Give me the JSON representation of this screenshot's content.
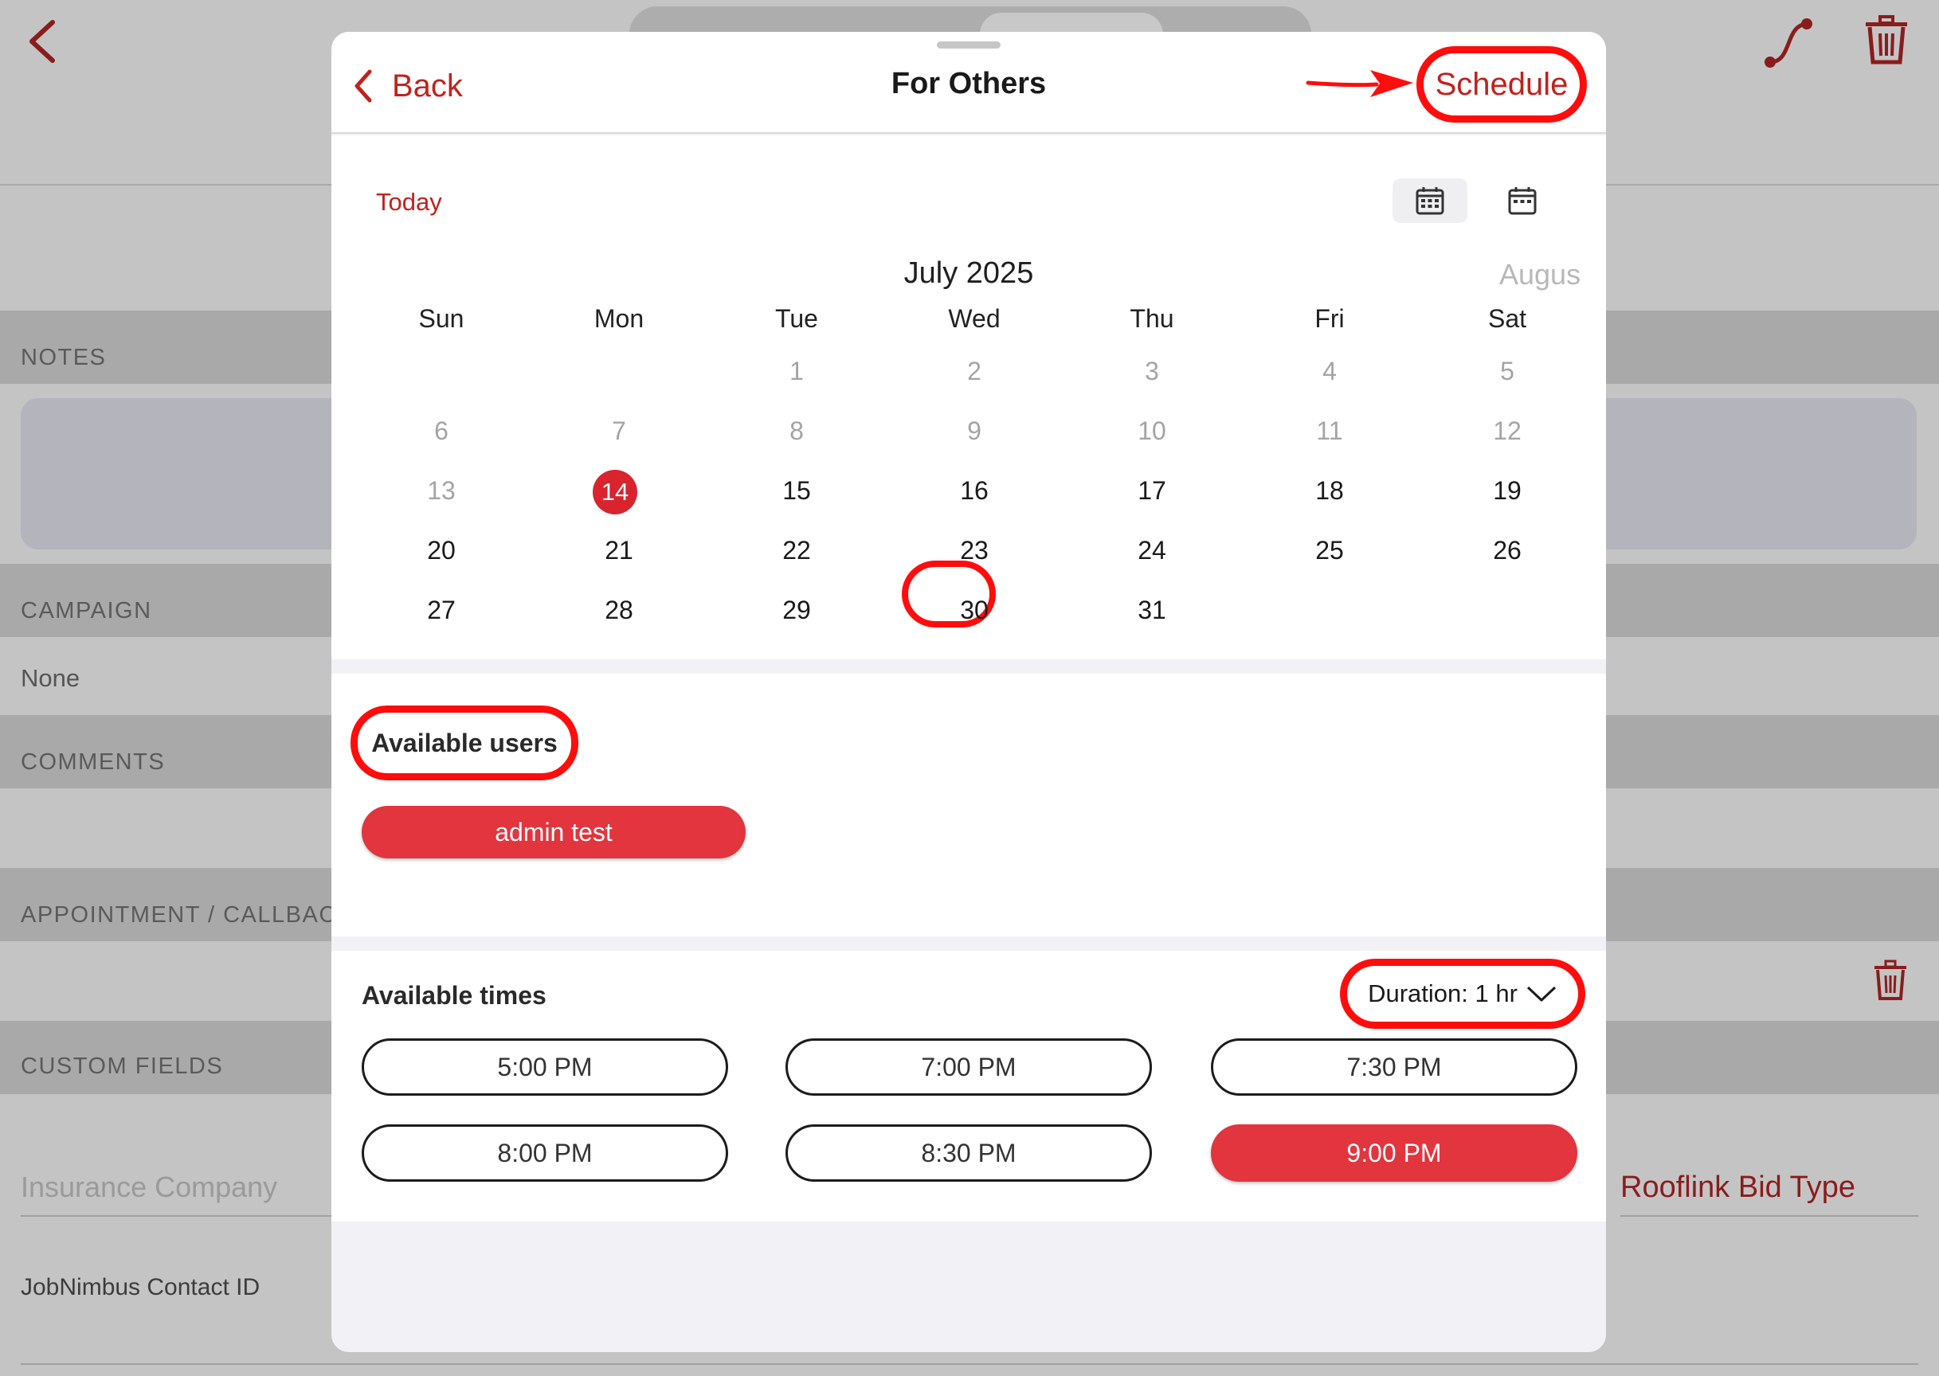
{
  "background": {
    "sections": {
      "notes": "NOTES",
      "campaign": "CAMPAIGN",
      "campaign_value": "None",
      "comments": "COMMENTS",
      "appointment": "APPOINTMENT / CALLBACK",
      "custom_fields": "CUSTOM FIELDS"
    },
    "fields": {
      "insurance_placeholder": "Insurance Company",
      "rooflink_label": "Rooflink Bid Type",
      "jobnimbus_label": "JobNimbus Contact ID"
    },
    "icons": {
      "back": "chevron-left-icon",
      "route": "route-icon",
      "trash": "trash-icon"
    }
  },
  "modal": {
    "back_label": "Back",
    "title": "For Others",
    "schedule_label": "Schedule"
  },
  "calendar": {
    "today_label": "Today",
    "month_label": "July 2025",
    "next_month_label": "Augus",
    "weekdays": [
      "Sun",
      "Mon",
      "Tue",
      "Wed",
      "Thu",
      "Fri",
      "Sat"
    ],
    "weeks": [
      [
        "",
        "",
        "1",
        "2",
        "3",
        "4",
        "5"
      ],
      [
        "6",
        "7",
        "8",
        "9",
        "10",
        "11",
        "12"
      ],
      [
        "13",
        "14",
        "15",
        "16",
        "17",
        "18",
        "19"
      ],
      [
        "20",
        "21",
        "22",
        "23",
        "24",
        "25",
        "26"
      ],
      [
        "27",
        "28",
        "29",
        "30",
        "31",
        "",
        ""
      ]
    ],
    "selected_day": "14"
  },
  "users": {
    "heading": "Available users",
    "list": [
      "admin test"
    ]
  },
  "times": {
    "heading": "Available times",
    "duration_label": "Duration: 1 hr",
    "slots": [
      "5:00 PM",
      "7:00 PM",
      "7:30 PM",
      "8:00 PM",
      "8:30 PM",
      "9:00 PM"
    ],
    "selected_slot": "9:00 PM"
  },
  "colors": {
    "accent": "#c0221d",
    "chip": "#e2353e",
    "annotation": "#ff0d0d"
  }
}
